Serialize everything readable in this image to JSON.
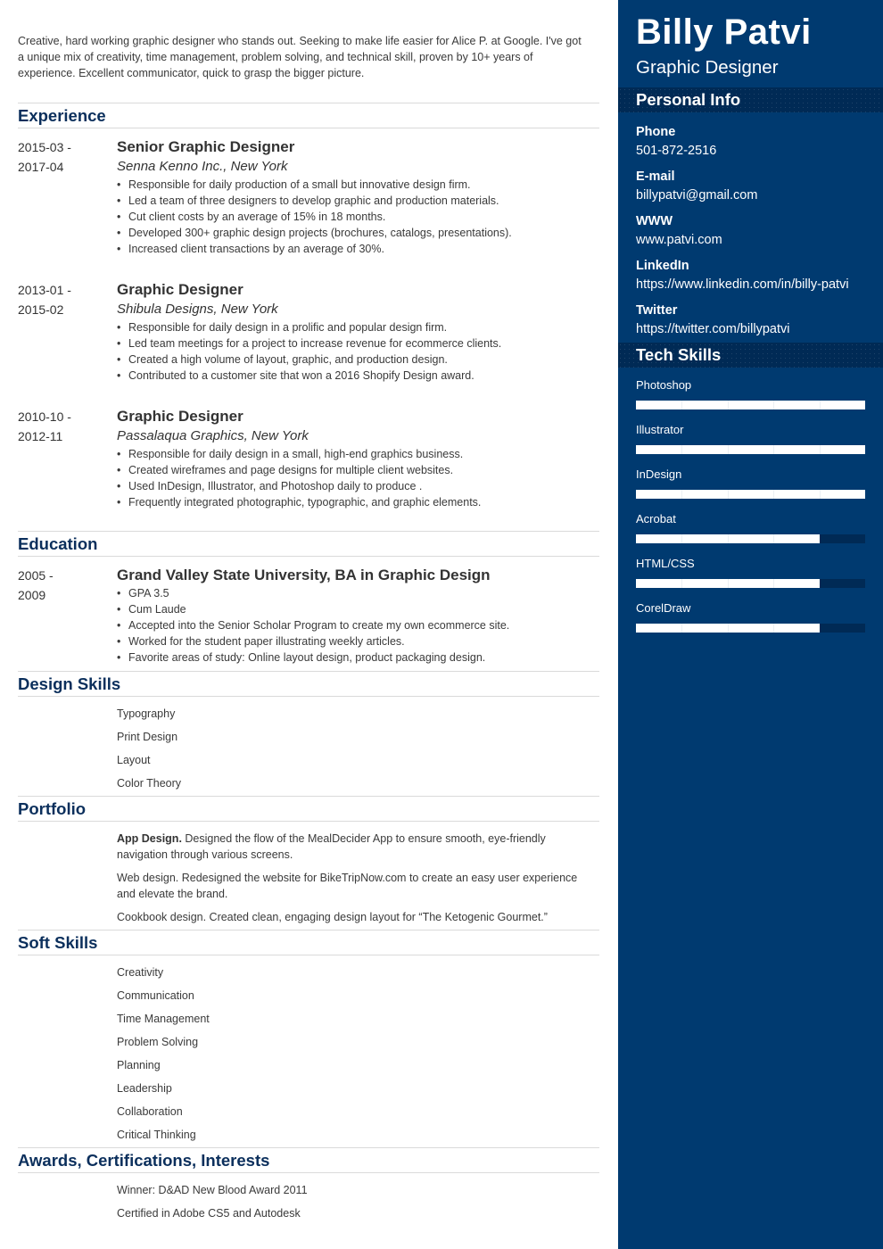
{
  "summary": "Creative, hard working graphic designer who stands out. Seeking to make life easier for Alice P. at Google. I've got a unique mix of creativity, time management, problem solving, and technical skill, proven by 10+ years of experience. Excellent communicator, quick to grasp the bigger picture.",
  "experience": {
    "heading": "Experience",
    "entries": [
      {
        "date_start": "2015-03 -",
        "date_end": "2017-04",
        "title": "Senior Graphic Designer",
        "company": "Senna Kenno Inc., New York",
        "bullets": [
          "Responsible for daily production of a small but innovative design firm.",
          "Led a team of three designers to develop graphic and production materials.",
          "Cut client costs by an average of 15% in 18 months.",
          "Developed 300+ graphic design projects (brochures, catalogs, presentations).",
          "Increased client transactions by an average of 30%."
        ]
      },
      {
        "date_start": "2013-01 -",
        "date_end": "2015-02",
        "title": "Graphic Designer",
        "company": "Shibula Designs, New York",
        "bullets": [
          "Responsible for daily design in a prolific and popular design firm.",
          "Led team meetings for a project to increase revenue for ecommerce clients.",
          "Created a high volume of layout, graphic, and production design.",
          "Contributed to a customer site that won a 2016 Shopify Design award."
        ]
      },
      {
        "date_start": "2010-10 -",
        "date_end": "2012-11",
        "title": "Graphic Designer",
        "company": "Passalaqua Graphics, New York",
        "bullets": [
          "Responsible for daily design in a small, high-end graphics business.",
          "Created wireframes and page designs for multiple client websites.",
          "Used InDesign, Illustrator, and Photoshop daily to produce .",
          "Frequently integrated photographic, typographic, and graphic elements."
        ]
      }
    ]
  },
  "education": {
    "heading": "Education",
    "entries": [
      {
        "date_start": "2005 -",
        "date_end": "2009",
        "title": "Grand Valley State University, BA in Graphic Design",
        "bullets": [
          "GPA 3.5",
          "Cum Laude",
          "Accepted into the Senior Scholar Program to create my own ecommerce site.",
          "Worked for the student paper illustrating weekly articles.",
          "Favorite areas of study: Online layout design, product packaging design."
        ]
      }
    ]
  },
  "design_skills": {
    "heading": "Design Skills",
    "items": [
      "Typography",
      "Print Design",
      "Layout",
      "Color Theory"
    ]
  },
  "portfolio": {
    "heading": "Portfolio",
    "items": [
      {
        "bold": "App Design.",
        "text": " Designed the flow of the MealDecider App to ensure smooth, eye-friendly navigation through various screens."
      },
      {
        "bold": "",
        "text": "Web design. Redesigned the website for BikeTripNow.com to create an easy user experience and elevate the brand."
      },
      {
        "bold": "",
        "text": "Cookbook design. Created clean, engaging design layout for “The Ketogenic Gourmet.”"
      }
    ]
  },
  "soft_skills": {
    "heading": "Soft Skills",
    "items": [
      "Creativity",
      "Communication",
      "Time Management",
      "Problem Solving",
      "Planning",
      "Leadership",
      "Collaboration",
      "Critical Thinking"
    ]
  },
  "awards": {
    "heading": "Awards, Certifications, Interests",
    "items": [
      "Winner: D&AD New Blood Award 2011",
      "Certified in Adobe CS5 and Autodesk"
    ]
  },
  "sidebar": {
    "name": "Billy Patvi",
    "role": "Graphic Designer",
    "personal_info": {
      "heading": "Personal Info",
      "items": [
        {
          "label": "Phone",
          "value": "501-872-2516"
        },
        {
          "label": "E-mail",
          "value": "billypatvi@gmail.com"
        },
        {
          "label": "WWW",
          "value": "www.patvi.com"
        },
        {
          "label": "LinkedIn",
          "value": "https://www.linkedin.com/in/billy-patvi"
        },
        {
          "label": "Twitter",
          "value": "https://twitter.com/billypatvi"
        }
      ]
    },
    "tech_skills": {
      "heading": "Tech Skills",
      "items": [
        {
          "name": "Photoshop",
          "level": 1.0
        },
        {
          "name": "Illustrator",
          "level": 1.0
        },
        {
          "name": "InDesign",
          "level": 1.0
        },
        {
          "name": "Acrobat",
          "level": 0.8
        },
        {
          "name": "HTML/CSS",
          "level": 0.8
        },
        {
          "name": "CorelDraw",
          "level": 0.8
        }
      ]
    }
  },
  "colors": {
    "sidebar_bg": "#003a70",
    "sidebar_header_bg": "#002a55",
    "heading_text": "#0b2f5c"
  }
}
